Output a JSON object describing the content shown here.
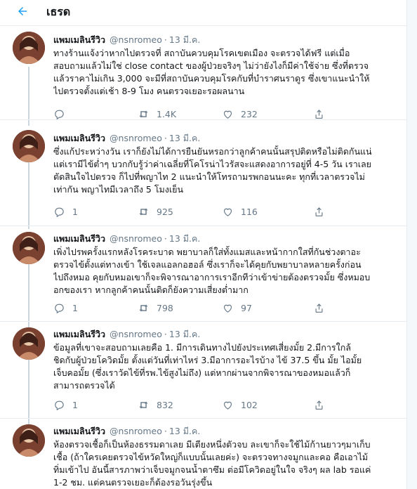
{
  "header": {
    "title": "เธรด"
  },
  "author": {
    "name": "แพมเมลินรีวิว",
    "handle": "@nsnromeo",
    "date": "13 มี.ค."
  },
  "tweets": [
    {
      "lines": [
        "ทางร้านแจ้งว่าหากไปตรวจที่ สถาบันควบคุมโรคเขตเมือง จะตรวจได้ฟรี แต่เมื่อ",
        "สอบถามแล้วไม่ใช่ close contact ของผู้ป่วยจริงๆ ไม่ว่ายังไงก็มีค่าใช้จ่าย ซึ่งที่ตรวจ",
        "แล้วราคาไม่เกิน 3,000 จะมีที่สถาบันควบคุมโรคกับที่บำราศนราดูร ซึ่งเขาแนะนำให้",
        "ไปตรวจตั้งแต่เช้า 8-9 โมง คนตรวจเยอะรอผลนาน"
      ],
      "reply": "",
      "retweets": "1.4K",
      "likes": "232"
    },
    {
      "lines": [
        "ซึ่งแก้ประหว่างวัน เราก็ยังไม่ได้การยืนยันหรอกว่าลูกค้าคนนั้นสรุปติดหรือไม่ติดกันแน่",
        "แต่เรามีไข้ต่ำๆ บวกกับรู้ว่าค่าเฉลี่ยที่โคโรน่าไวรัสจะแสดงอาการอยู่ที่ 4-5 วัน เราเลย",
        "ตัดสินใจไปตรวจ ก็ไปที่พญาไท 2 แนะนำให้โทรถามรพกอนนะคะ ทุกที่เวลาตรวจไม่",
        "เท่ากัน พญาไทมีเวลาถึง 5 โมงเย็น"
      ],
      "reply": "1",
      "retweets": "925",
      "likes": "116"
    },
    {
      "lines": [
        "เพิ่งไปรพครั้งแรกหลังโรคระบาด พยาบาลก็ใส่ทั้งแมสและหน้ากากใสที่กันช่วงตาอะ",
        "ตรวจไข้ตั้งแต่ทางเข้า ใช้เจลแอลกอฮอล์ ซึ่งเราก็จะได้คุยกับพยาบาลหลายครั้งก่อน",
        "ไปถึงหมอ คุยกับหมอเขาก็จะพิจารณาอาการเราอีกทีว่าเข้าข่ายต้องตรวจมั้ย ซึ่งหมอบ",
        "อกของเรา หากลูกค้าคนนั้นติดก็ยังความเสี่ยงต่ำมาก"
      ],
      "reply": "1",
      "retweets": "798",
      "likes": "97"
    },
    {
      "lines": [
        "ข้อมูลที่เขาจะสอบถามเลยคือ 1. มีการเดินทางไปยังประเทศเสี่ยงมั้ย 2.มีการใกล้",
        "ชิดกับผู้ป่วยโควิดมั้ย ตั้งแต่วันที่เท่าไหร่ 3.มีอาการอะไรบ้าง ไข้ 37.5 ขึ้น มั้ย ไอมั้ย",
        "เจ็บคอมั้ย (ซึ่งเราวัดไข้ที่รพ.ไข้สูงไม่ถึง) แต่หากผ่านจากพิจารณาของหมอแล้วก็",
        "สามารถตรวจได้"
      ],
      "reply": "1",
      "retweets": "832",
      "likes": "102"
    },
    {
      "lines": [
        "ห้องตรวจเชื้อก็เป็นห้องธรรมดาเลย มีเตียงหนึ่งตัวจบ ละเขาก็จะใช้ไม้ก้านยาวๆมาเก็บ",
        "เชื้อ (ถ้าใครเคยตรวจไข้หวัดใหญ่ก็แบบนั้นเลยค่ะ) จะตรวจทางจมูกและคอ คือเอาไม้",
        "ทิ่มเข้าไป อันนี้สารภาพว่าเจ็บจมูกจนน้ำตาซึม ต่อมีโควิดอยู่ในใจ จริงๆ ผล lab รอแค่",
        "1-2 ชม. แต่คนตรวจเยอะก็ต้องรอวันรุ่งขึ้น"
      ],
      "reply": "",
      "retweets": "",
      "likes": ""
    }
  ],
  "colors": {
    "accent": "#1da1f2",
    "text": "#14171a",
    "muted": "#657786",
    "divider": "#e6ecf0"
  }
}
